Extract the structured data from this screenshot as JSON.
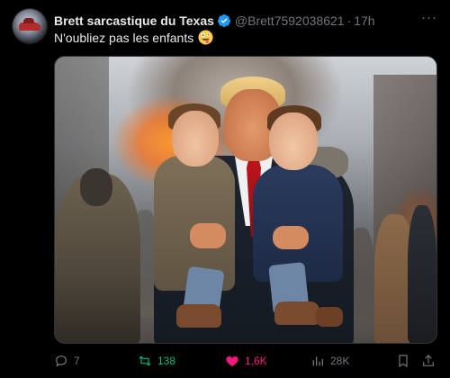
{
  "tweet": {
    "author_name": "Brett sarcastique du Texas",
    "handle": "@Brett7592038621",
    "separator": "·",
    "time": "17h",
    "text": "N'oubliez pas les enfants",
    "emoji": "zany-face-emoji",
    "more_label": "···"
  },
  "actions": {
    "replies": "7",
    "retweets": "138",
    "likes": "1,6K",
    "views": "28K"
  },
  "colors": {
    "background": "#000000",
    "text": "#e7e9ea",
    "muted": "#71767b",
    "verified": "#1d9bf0",
    "retweet_active": "#00ba7c",
    "like_active": "#f91880"
  },
  "icons": [
    "reply-icon",
    "retweet-icon",
    "like-icon",
    "views-icon",
    "bookmark-icon",
    "share-icon",
    "verified-icon",
    "more-icon"
  ]
}
